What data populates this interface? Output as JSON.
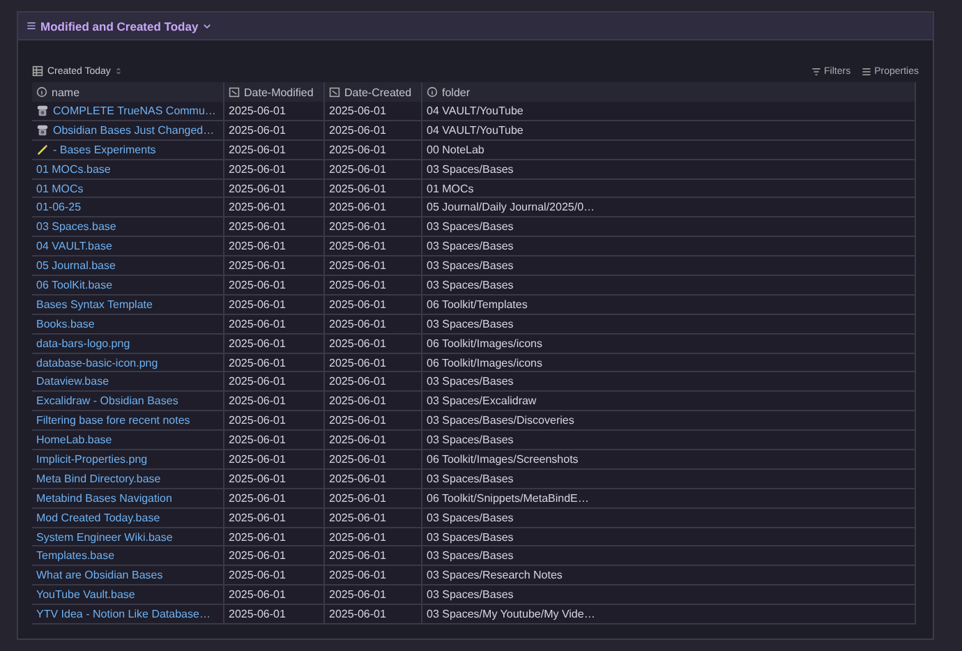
{
  "header": {
    "title": "Modified and Created Today",
    "expanded": true
  },
  "toolbar": {
    "view": "Created Today",
    "actions": [
      {
        "kind": "filter",
        "label": "Filters"
      },
      {
        "kind": "list",
        "label": "Properties"
      }
    ]
  },
  "table": {
    "columns": [
      {
        "kind": "info",
        "label": "name"
      },
      {
        "kind": "date",
        "label": "Date-Modified"
      },
      {
        "kind": "date",
        "label": "Date-Created"
      },
      {
        "kind": "info",
        "label": "folder"
      }
    ],
    "rows": [
      {
        "kind": "phone",
        "name": "COMPLETE TrueNAS Commu…",
        "modified": "2025-06-01",
        "created": "2025-06-01",
        "folder": "04 VAULT/YouTube"
      },
      {
        "kind": "phone",
        "name": "Obsidian Bases Just Changed…",
        "modified": "2025-06-01",
        "created": "2025-06-01",
        "folder": "04 VAULT/YouTube"
      },
      {
        "kind": "pencil",
        "name": "- Bases Experiments",
        "modified": "2025-06-01",
        "created": "2025-06-01",
        "folder": "00 NoteLab"
      },
      {
        "name": "01 MOCs.base",
        "modified": "2025-06-01",
        "created": "2025-06-01",
        "folder": "03 Spaces/Bases"
      },
      {
        "name": "01 MOCs",
        "modified": "2025-06-01",
        "created": "2025-06-01",
        "folder": "01 MOCs"
      },
      {
        "name": "01-06-25",
        "modified": "2025-06-01",
        "created": "2025-06-01",
        "folder": "05 Journal/Daily Journal/2025/0…"
      },
      {
        "name": "03 Spaces.base",
        "modified": "2025-06-01",
        "created": "2025-06-01",
        "folder": "03 Spaces/Bases"
      },
      {
        "name": "04 VAULT.base",
        "modified": "2025-06-01",
        "created": "2025-06-01",
        "folder": "03 Spaces/Bases"
      },
      {
        "name": "05 Journal.base",
        "modified": "2025-06-01",
        "created": "2025-06-01",
        "folder": "03 Spaces/Bases"
      },
      {
        "name": "06 ToolKit.base",
        "modified": "2025-06-01",
        "created": "2025-06-01",
        "folder": "03 Spaces/Bases"
      },
      {
        "name": "Bases Syntax Template",
        "modified": "2025-06-01",
        "created": "2025-06-01",
        "folder": "06 Toolkit/Templates"
      },
      {
        "name": "Books.base",
        "modified": "2025-06-01",
        "created": "2025-06-01",
        "folder": "03 Spaces/Bases"
      },
      {
        "name": "data-bars-logo.png",
        "modified": "2025-06-01",
        "created": "2025-06-01",
        "folder": "06 Toolkit/Images/icons"
      },
      {
        "name": "database-basic-icon.png",
        "modified": "2025-06-01",
        "created": "2025-06-01",
        "folder": "06 Toolkit/Images/icons"
      },
      {
        "name": "Dataview.base",
        "modified": "2025-06-01",
        "created": "2025-06-01",
        "folder": "03 Spaces/Bases"
      },
      {
        "name": "Excalidraw - Obsidian Bases",
        "modified": "2025-06-01",
        "created": "2025-06-01",
        "folder": "03 Spaces/Excalidraw"
      },
      {
        "name": "Filtering base fore recent notes",
        "modified": "2025-06-01",
        "created": "2025-06-01",
        "folder": "03 Spaces/Bases/Discoveries"
      },
      {
        "name": "HomeLab.base",
        "modified": "2025-06-01",
        "created": "2025-06-01",
        "folder": "03 Spaces/Bases"
      },
      {
        "name": "Implicit-Properties.png",
        "modified": "2025-06-01",
        "created": "2025-06-01",
        "folder": "06 Toolkit/Images/Screenshots"
      },
      {
        "name": "Meta Bind Directory.base",
        "modified": "2025-06-01",
        "created": "2025-06-01",
        "folder": "03 Spaces/Bases"
      },
      {
        "name": "Metabind Bases Navigation",
        "modified": "2025-06-01",
        "created": "2025-06-01",
        "folder": "06 Toolkit/Snippets/MetaBindE…"
      },
      {
        "name": "Mod Created Today.base",
        "modified": "2025-06-01",
        "created": "2025-06-01",
        "folder": "03 Spaces/Bases"
      },
      {
        "name": "System Engineer Wiki.base",
        "modified": "2025-06-01",
        "created": "2025-06-01",
        "folder": "03 Spaces/Bases"
      },
      {
        "name": "Templates.base",
        "modified": "2025-06-01",
        "created": "2025-06-01",
        "folder": "03 Spaces/Bases"
      },
      {
        "name": "What are Obsidian Bases",
        "modified": "2025-06-01",
        "created": "2025-06-01",
        "folder": "03 Spaces/Research Notes"
      },
      {
        "name": "YouTube Vault.base",
        "modified": "2025-06-01",
        "created": "2025-06-01",
        "folder": "03 Spaces/Bases"
      },
      {
        "name": "YTV Idea - Notion Like Database…",
        "modified": "2025-06-01",
        "created": "2025-06-01",
        "folder": "03 Spaces/My Youtube/My Vide…"
      }
    ]
  }
}
